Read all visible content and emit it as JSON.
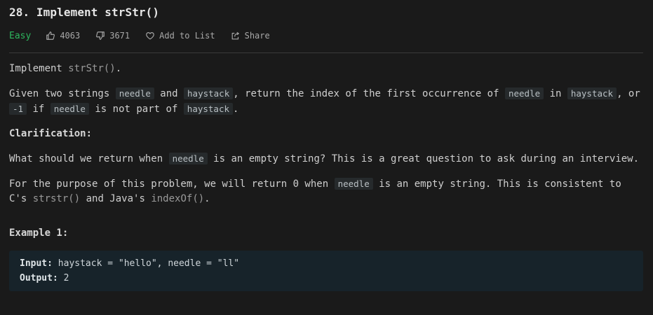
{
  "problem": {
    "number_title": "28. Implement strStr()",
    "difficulty": "Easy",
    "likes": "4063",
    "dislikes": "3671",
    "add_to_list": "Add to List",
    "share": "Share"
  },
  "description": {
    "p1_prefix": "Implement ",
    "p1_fn": "strStr()",
    "p1_suffix": ".",
    "p2": {
      "t1": "Given two strings ",
      "c1": "needle",
      "t2": " and ",
      "c2": "haystack",
      "t3": ", return the index of the first occurrence of ",
      "c3": "needle",
      "t4": " in ",
      "c4": "haystack",
      "t5": ", or ",
      "c5": "-1",
      "t6": " if ",
      "c6": "needle",
      "t7": " is not part of ",
      "c7": "haystack",
      "t8": "."
    },
    "clarification_heading": "Clarification:",
    "p3": {
      "t1": "What should we return when ",
      "c1": "needle",
      "t2": " is an empty string? This is a great question to ask during an interview."
    },
    "p4": {
      "t1": "For the purpose of this problem, we will return 0 when ",
      "c1": "needle",
      "t2": " is an empty string. This is consistent to C's ",
      "f1": "strstr()",
      "t3": " and Java's ",
      "f2": "indexOf()",
      "t4": "."
    },
    "example_heading": "Example 1:",
    "example": {
      "input_label": "Input:",
      "input_value": " haystack = \"hello\", needle = \"ll\"",
      "output_label": "Output:",
      "output_value": " 2"
    }
  },
  "colors": {
    "background": "#1a1a1a",
    "easy": "#2db55d",
    "code_bg": "#262a2c",
    "example_bg": "#17232a"
  }
}
